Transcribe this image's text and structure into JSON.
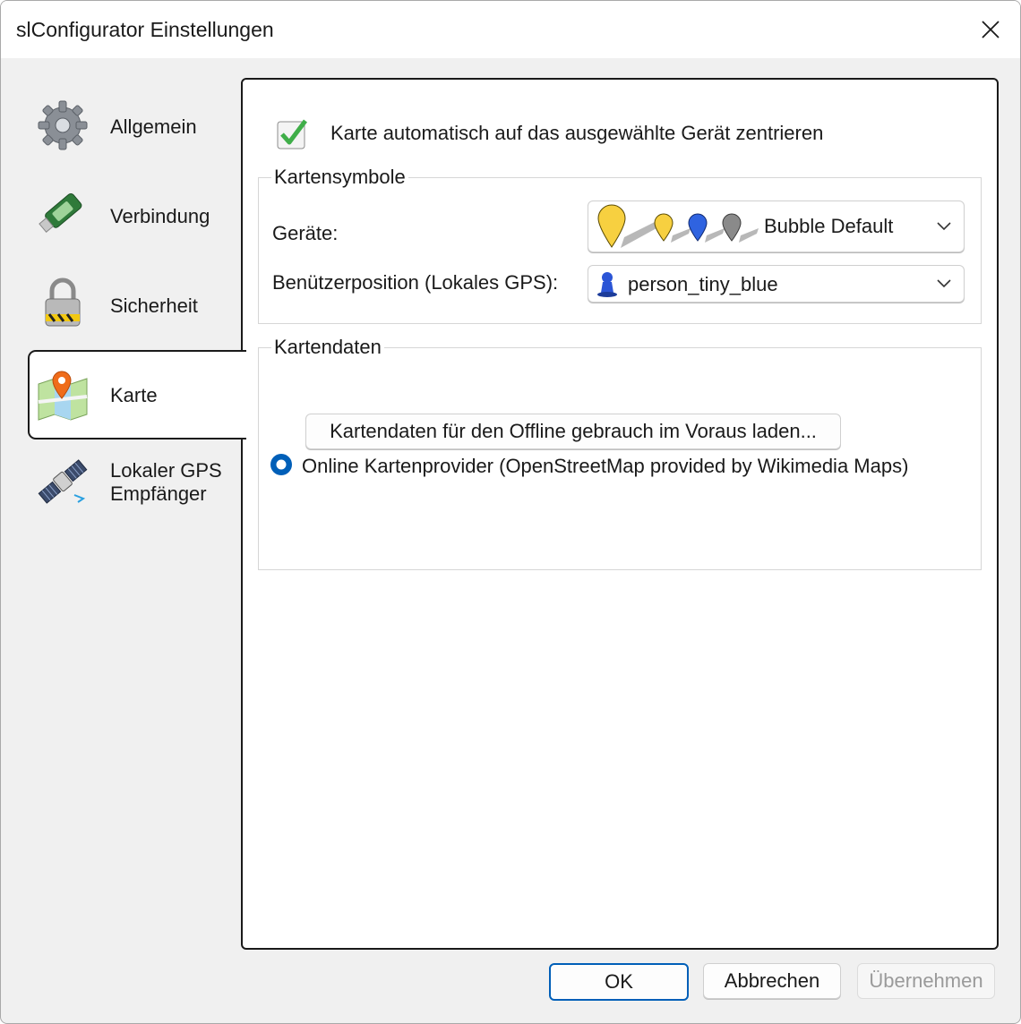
{
  "window": {
    "title": "slConfigurator Einstellungen",
    "close_label": "✕"
  },
  "sidebar": {
    "items": [
      {
        "label": "Allgemein",
        "icon": "gear-icon"
      },
      {
        "label": "Verbindung",
        "icon": "usb-stick-icon"
      },
      {
        "label": "Sicherheit",
        "icon": "padlock-icon"
      },
      {
        "label": "Karte",
        "icon": "map-pin-icon",
        "selected": true
      },
      {
        "label": "Lokaler GPS Empfänger",
        "icon": "satellite-icon"
      }
    ]
  },
  "karte": {
    "auto_center": {
      "label": "Karte automatisch auf das ausgewählte Gerät zentrieren",
      "checked": true
    },
    "kartensymbole": {
      "title": "Kartensymbole",
      "geraete_label": "Geräte:",
      "geraete_value": "Bubble Default",
      "position_label": "Benützerposition (Lokales GPS):",
      "position_value": "person_tiny_blue"
    },
    "kartendaten": {
      "title": "Kartendaten",
      "provider_label": "Online Kartenprovider (OpenStreetMap provided by Wikimedia Maps)",
      "provider_selected": true,
      "preload_button": "Kartendaten für den Offline gebrauch im Voraus laden..."
    }
  },
  "footer": {
    "ok": "OK",
    "cancel": "Abbrechen",
    "apply": "Übernehmen"
  },
  "colors": {
    "accent": "#005fb8",
    "check": "#3fae49",
    "disabled_text": "#9a9a9a"
  }
}
